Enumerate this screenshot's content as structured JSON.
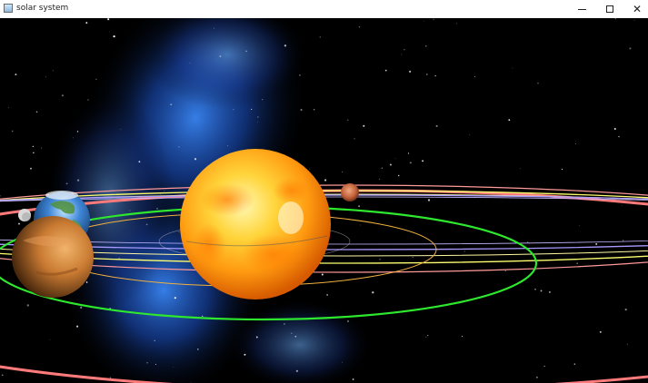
{
  "window": {
    "title": "solar system",
    "icon": "app-window-icon",
    "controls": {
      "minimize": "minimize-icon",
      "maximize": "maximize-icon",
      "close": "close-icon"
    }
  },
  "scene": {
    "background": "#000000",
    "nebula_color": "#1f5fd6",
    "bodies": [
      {
        "name": "sun",
        "color": "#ffb400"
      },
      {
        "name": "earth",
        "color": "#3a7fd0"
      },
      {
        "name": "venus",
        "color": "#d9843a"
      },
      {
        "name": "mars",
        "color": "#c7643b"
      },
      {
        "name": "moon",
        "color": "#cccccc"
      }
    ],
    "orbit_colors": [
      "#f0b040",
      "#39e639",
      "#ff8080",
      "#ffff80",
      "#b0a0ff"
    ]
  }
}
